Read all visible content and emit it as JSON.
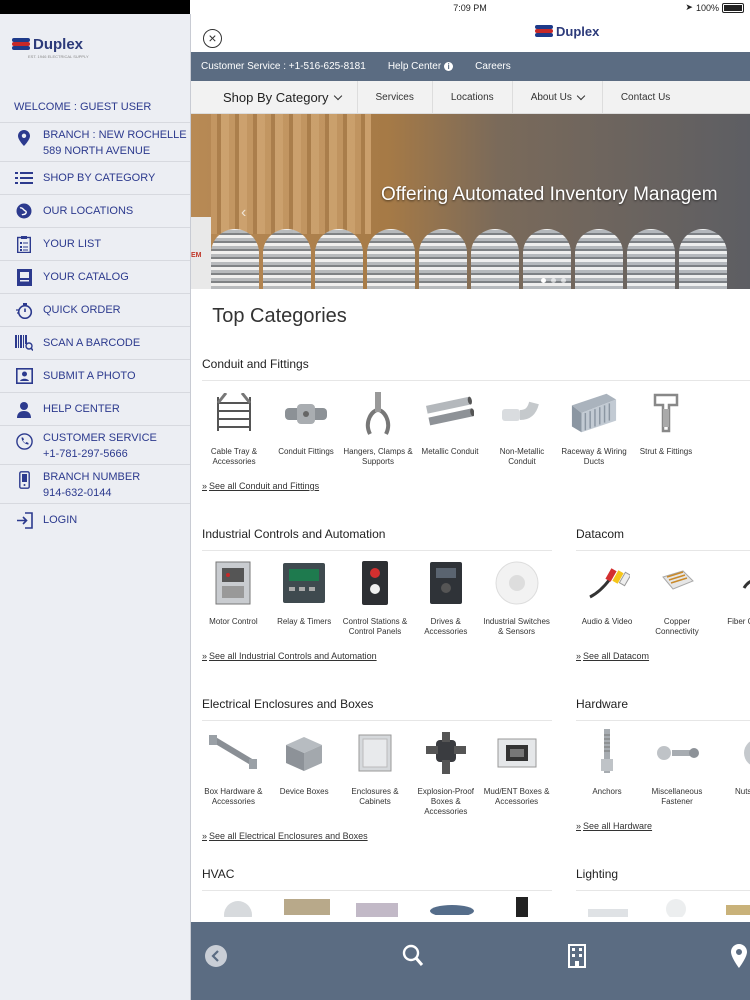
{
  "status": {
    "time": "7:09 PM",
    "battery": "100%"
  },
  "sidebar": {
    "logo_text": "Duplex",
    "logo_sub": "EST. 1946 ELECTRICAL SUPPLY",
    "welcome": "WELCOME : GUEST USER",
    "branch_line1": "BRANCH : NEW ROCHELLE",
    "branch_line2": "589 NORTH AVENUE",
    "items": [
      {
        "label": "SHOP BY CATEGORY",
        "icon": "list-icon"
      },
      {
        "label": "OUR LOCATIONS",
        "icon": "globe-icon"
      },
      {
        "label": "YOUR LIST",
        "icon": "checklist-icon"
      },
      {
        "label": "YOUR CATALOG",
        "icon": "catalog-icon"
      },
      {
        "label": "QUICK ORDER",
        "icon": "stopwatch-icon"
      },
      {
        "label": "SCAN A BARCODE",
        "icon": "barcode-icon"
      },
      {
        "label": "SUBMIT A PHOTO",
        "icon": "photo-id-icon"
      },
      {
        "label": "HELP CENTER",
        "icon": "support-agent-icon"
      }
    ],
    "customer_service_label": "CUSTOMER SERVICE",
    "customer_service_phone": "+1-781-297-5666",
    "branch_number_label": "BRANCH NUMBER",
    "branch_number_phone": "914-632-0144",
    "login": "LOGIN"
  },
  "header": {
    "logo_text": "Duplex",
    "customer_service": "Customer Service : +1-516-625-8181",
    "help_center": "Help Center",
    "careers": "Careers"
  },
  "nav": {
    "shop_by_category": "Shop By Category",
    "services": "Services",
    "locations": "Locations",
    "about_us": "About Us",
    "contact_us": "Contact Us"
  },
  "banner": {
    "text": "Offering Automated Inventory Managem",
    "side_tab": "EM"
  },
  "main": {
    "top_categories": "Top Categories",
    "sections": {
      "conduit": {
        "title": "Conduit and Fittings",
        "items": [
          "Cable Tray & Accessories",
          "Conduit Fittings",
          "Hangers, Clamps & Supports",
          "Metallic Conduit",
          "Non-Metallic Conduit",
          "Raceway & Wiring Ducts",
          "Strut & Fittings"
        ],
        "see_all": "See all Conduit and Fittings"
      },
      "controls": {
        "title": "Industrial Controls and Automation",
        "items": [
          "Motor Control",
          "Relay & Timers",
          "Control Stations & Control Panels",
          "Drives & Accessories",
          "Industrial Switches & Sensors"
        ],
        "see_all": "See all Industrial Controls and Automation"
      },
      "datacom": {
        "title": "Datacom",
        "items": [
          "Audio & Video",
          "Copper Connectivity",
          "Fiber Conn"
        ],
        "see_all": "See all Datacom"
      },
      "enclosures": {
        "title": "Electrical Enclosures and Boxes",
        "items": [
          "Box Hardware & Accessories",
          "Device Boxes",
          "Enclosures & Cabinets",
          "Explosion-Proof Boxes & Accessories",
          "Mud/ENT Boxes & Accessories"
        ],
        "see_all": "See all Electrical Enclosures and Boxes"
      },
      "hardware": {
        "title": "Hardware",
        "items": [
          "Anchors",
          "Miscellaneous Fastener",
          "Nuts &"
        ],
        "see_all": "See all Hardware"
      },
      "hvac": {
        "title": "HVAC"
      },
      "lighting": {
        "title": "Lighting"
      }
    }
  },
  "colors": {
    "brand_blue": "#2c3a8e",
    "bar_slate": "#5b6c82",
    "sidebar_bg": "#eceef3"
  }
}
